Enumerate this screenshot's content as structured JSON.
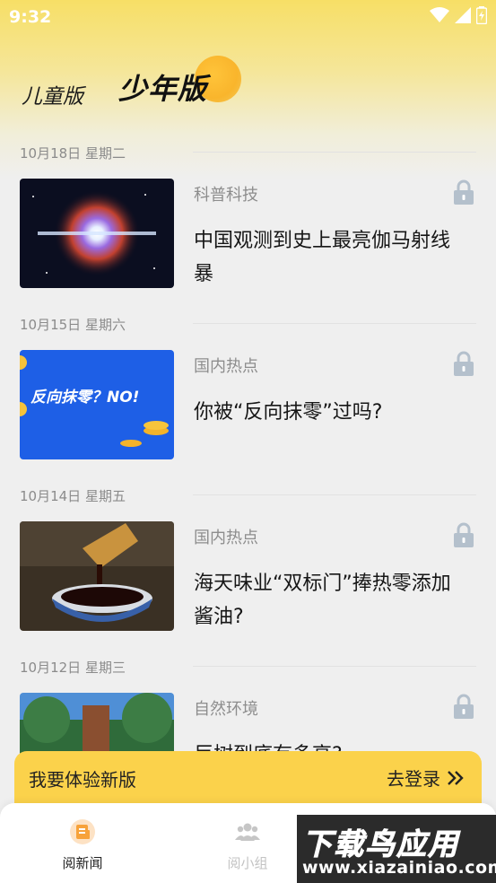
{
  "status_bar": {
    "time": "9:32"
  },
  "header": {
    "tab_kids": "儿童版",
    "tab_teen": "少年版"
  },
  "feed": {
    "items": [
      {
        "date": "10月18日 星期二",
        "category": "科普科技",
        "title": "中国观测到史上最亮伽马射线暴",
        "thumb": "space-burst"
      },
      {
        "date": "10月15日 星期六",
        "category": "国内热点",
        "title": "你被“反向抹零”过吗?",
        "thumb_text": "反向抹零？NO!"
      },
      {
        "date": "10月14日 星期五",
        "category": "国内热点",
        "title": "海天味业“双标门”捧热零添加酱油?",
        "thumb": "soy-sauce"
      },
      {
        "date": "10月12日 星期三",
        "category": "自然环境",
        "title": "巨树到底有多高?",
        "thumb": "giant-tree"
      }
    ]
  },
  "promo": {
    "text": "我要体验新版",
    "login": "去登录"
  },
  "bottom_nav": {
    "news": "阅新闻",
    "group": "阅小组"
  },
  "watermark": {
    "main": "下载鸟应用",
    "sub": "www.xiazainiao.com"
  },
  "colors": {
    "accent": "#fbd24b",
    "sun": "#f9b52c",
    "nav_active_icon": "#f7a23a"
  }
}
